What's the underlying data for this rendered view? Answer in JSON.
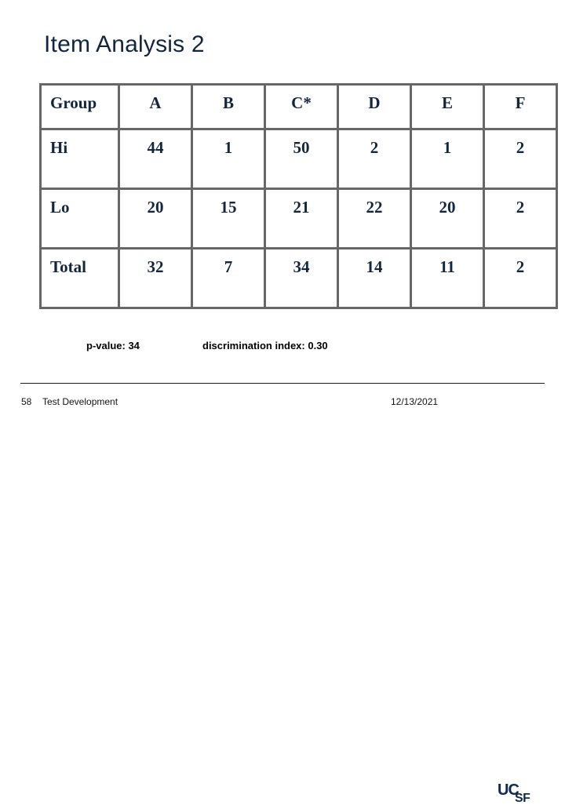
{
  "slide": {
    "title": "Item Analysis 2"
  },
  "table": {
    "headers": [
      "Group",
      "A",
      "B",
      "C*",
      "D",
      "E",
      "F"
    ],
    "rows": [
      {
        "group": "Hi",
        "values": [
          "44",
          "1",
          "50",
          "2",
          "1",
          "2"
        ]
      },
      {
        "group": "Lo",
        "values": [
          "20",
          "15",
          "21",
          "22",
          "20",
          "2"
        ]
      },
      {
        "group": "Total",
        "values": [
          "32",
          "7",
          "34",
          "14",
          "11",
          "2"
        ]
      }
    ]
  },
  "stats": {
    "p_value": "p-value: 34",
    "discrimination_index": "discrimination index: 0.30"
  },
  "footer": {
    "slide_number": "58",
    "section": "Test Development",
    "date": "12/13/2021",
    "logo_alt": "UCSF"
  },
  "colors": {
    "title_navy": "#12263f",
    "table_text_navy": "#12263f",
    "table_border_gray": "#676767",
    "footer_text": "#121212",
    "logo_navy": "#0e2a4d",
    "background": "#ffffff"
  }
}
